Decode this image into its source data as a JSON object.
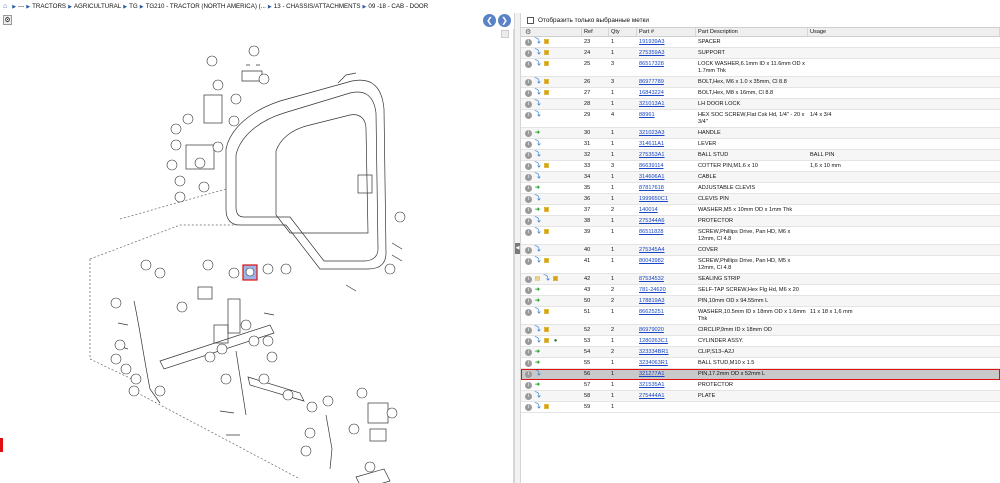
{
  "breadcrumb": {
    "home_icon": "home-icon",
    "items": [
      "---",
      "TRACTORS",
      "AGRICULTURAL",
      "TG",
      "TG210 - TRACTOR (NORTH AMERICA) (...",
      "13 - CHASSIS/ATTACHMENTS",
      "09 -18 - CAB - DOOR"
    ]
  },
  "nav": {
    "prev_icon": "arrow-left-icon",
    "next_icon": "arrow-right-icon"
  },
  "filter": {
    "label": "Отобразить только выбранные метки"
  },
  "table": {
    "headers": {
      "ref": "Ref",
      "qty": "Qty",
      "part": "Part #",
      "desc": "Part Description",
      "usage": "Usage"
    },
    "rows": [
      {
        "icons": [
          "info",
          "blue",
          "box"
        ],
        "ref": "23",
        "qty": "1",
        "part": "191939A3",
        "desc": "SPACER",
        "usage": ""
      },
      {
        "icons": [
          "info",
          "blue",
          "box"
        ],
        "ref": "24",
        "qty": "1",
        "part": "275359A3",
        "desc": "SUPPORT",
        "usage": ""
      },
      {
        "icons": [
          "info",
          "blue",
          "box"
        ],
        "ref": "25",
        "qty": "3",
        "part": "86517328",
        "desc": "LOCK WASHER,6.1mm ID x 11.6mm OD x 1.7mm Thk",
        "usage": ""
      },
      {
        "icons": [
          "info",
          "blue",
          "box"
        ],
        "ref": "26",
        "qty": "3",
        "part": "86977789",
        "desc": "BOLT,Hex, M6 x 1.0 x 35mm, Cl 8.8",
        "usage": ""
      },
      {
        "icons": [
          "info",
          "blue",
          "box"
        ],
        "ref": "27",
        "qty": "1",
        "part": "16843224",
        "desc": "BOLT,Hex, M8 x 16mm, Cl 8.8",
        "usage": ""
      },
      {
        "icons": [
          "info",
          "blue"
        ],
        "ref": "28",
        "qty": "1",
        "part": "321013A1",
        "desc": "LH DOOR LOCK",
        "usage": ""
      },
      {
        "icons": [
          "info",
          "blue"
        ],
        "ref": "29",
        "qty": "4",
        "part": "88961",
        "desc": "HEX SOC SCREW,Flat Csk Hd, 1/4\" - 20 x 3/4\"",
        "usage": "1/4 x 3/4"
      },
      {
        "icons": [
          "info",
          "green"
        ],
        "ref": "30",
        "qty": "1",
        "part": "321023A3",
        "desc": "HANDLE",
        "usage": ""
      },
      {
        "icons": [
          "info",
          "blue"
        ],
        "ref": "31",
        "qty": "1",
        "part": "314611A1",
        "desc": "LEVER",
        "usage": ""
      },
      {
        "icons": [
          "info",
          "blue"
        ],
        "ref": "32",
        "qty": "1",
        "part": "275353A1",
        "desc": "BALL STUD",
        "usage": "BALL PIN"
      },
      {
        "icons": [
          "info",
          "blue",
          "box"
        ],
        "ref": "33",
        "qty": "3",
        "part": "86639114",
        "desc": "COTTER PIN,M1.6 x 10",
        "usage": "1,6 x 10 mm"
      },
      {
        "icons": [
          "info",
          "blue"
        ],
        "ref": "34",
        "qty": "1",
        "part": "314606A1",
        "desc": "CABLE",
        "usage": ""
      },
      {
        "icons": [
          "info",
          "green"
        ],
        "ref": "35",
        "qty": "1",
        "part": "87817618",
        "desc": "ADJUSTABLE CLEVIS",
        "usage": ""
      },
      {
        "icons": [
          "info",
          "blue"
        ],
        "ref": "36",
        "qty": "1",
        "part": "1999650C1",
        "desc": "CLEVIS PIN",
        "usage": ""
      },
      {
        "icons": [
          "info",
          "green",
          "box"
        ],
        "ref": "37",
        "qty": "2",
        "part": "140014",
        "desc": "WASHER,M5 x 10mm OD x 1mm Thk",
        "usage": ""
      },
      {
        "icons": [
          "info",
          "blue"
        ],
        "ref": "38",
        "qty": "1",
        "part": "275344A6",
        "desc": "PROTECTOR",
        "usage": ""
      },
      {
        "icons": [
          "info",
          "blue",
          "box"
        ],
        "ref": "39",
        "qty": "1",
        "part": "86511828",
        "desc": "SCREW,Phillips Drive, Pan HD, M6 x 12mm, Cl 4.8",
        "usage": ""
      },
      {
        "icons": [
          "info",
          "blue"
        ],
        "ref": "40",
        "qty": "1",
        "part": "275345A4",
        "desc": "COVER",
        "usage": ""
      },
      {
        "icons": [
          "info",
          "blue",
          "box"
        ],
        "ref": "41",
        "qty": "1",
        "part": "80043982",
        "desc": "SCREW,Phillips Drive, Pan HD, M5 x 12mm, Cl 4.8",
        "usage": ""
      },
      {
        "icons": [
          "info",
          "fold",
          "blue",
          "box"
        ],
        "ref": "42",
        "qty": "1",
        "part": "87534532",
        "desc": "SEALING STRIP",
        "usage": ""
      },
      {
        "icons": [
          "info",
          "green"
        ],
        "ref": "43",
        "qty": "2",
        "part": "781-24620",
        "desc": "SELF-TAP SCREW,Hex Flg Hd, M6 x 20",
        "usage": ""
      },
      {
        "icons": [
          "info",
          "green"
        ],
        "ref": "50",
        "qty": "2",
        "part": "178819A3",
        "desc": "PIN,10mm OD x 94.55mm L",
        "usage": ""
      },
      {
        "icons": [
          "info",
          "blue",
          "box"
        ],
        "ref": "51",
        "qty": "1",
        "part": "86625251",
        "desc": "WASHER,10.5mm ID x 18mm OD x 1.6mm Thk",
        "usage": "11 x 18 x 1,6 mm"
      },
      {
        "icons": [
          "info",
          "blue",
          "box"
        ],
        "ref": "52",
        "qty": "2",
        "part": "86979020",
        "desc": "CIRCLIP,9mm ID x 18mm OD",
        "usage": ""
      },
      {
        "icons": [
          "info",
          "blue",
          "box",
          "globe"
        ],
        "ref": "53",
        "qty": "1",
        "part": "1280263C1",
        "desc": "CYLINDER ASSY.",
        "usage": ""
      },
      {
        "icons": [
          "info",
          "green"
        ],
        "ref": "54",
        "qty": "2",
        "part": "323334BR1",
        "desc": "CLIP,S13–A2J",
        "usage": ""
      },
      {
        "icons": [
          "info",
          "green"
        ],
        "ref": "55",
        "qty": "1",
        "part": "3234063R1",
        "desc": "BALL STUD,M10 x 1.5",
        "usage": ""
      },
      {
        "icons": [
          "info",
          "blue"
        ],
        "ref": "56",
        "qty": "1",
        "part": "321277A1",
        "desc": "PIN,17.2mm OD x 52mm L",
        "usage": "",
        "selected": true
      },
      {
        "icons": [
          "info",
          "green"
        ],
        "ref": "57",
        "qty": "1",
        "part": "321535A1",
        "desc": "PROTECTOR",
        "usage": ""
      },
      {
        "icons": [
          "info",
          "blue"
        ],
        "ref": "58",
        "qty": "1",
        "part": "275444A1",
        "desc": "PLATE",
        "usage": ""
      },
      {
        "icons": [
          "info",
          "blue",
          "box"
        ],
        "ref": "59",
        "qty": "1",
        "part": "",
        "desc": "",
        "usage": ""
      }
    ]
  }
}
